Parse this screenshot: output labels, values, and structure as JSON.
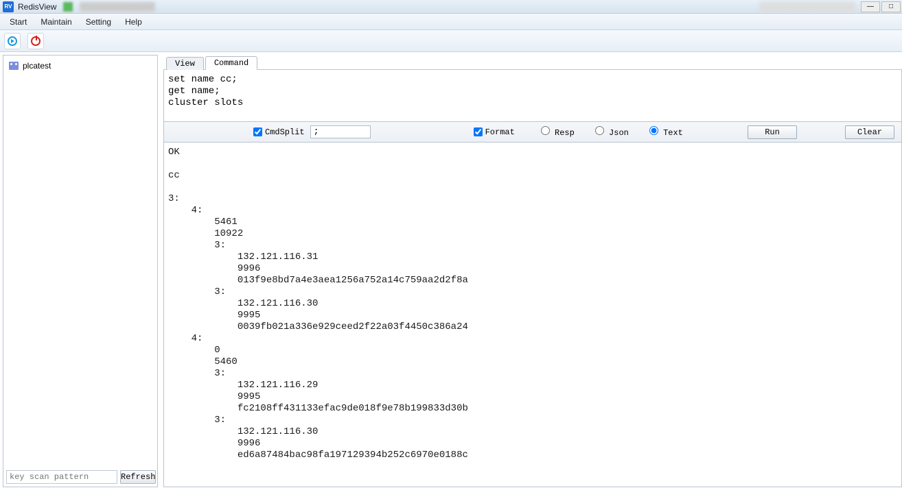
{
  "app": {
    "title": "RedisView"
  },
  "menubar": {
    "start": "Start",
    "maintain": "Maintain",
    "setting": "Setting",
    "help": "Help"
  },
  "sidebar": {
    "tree": {
      "item0": "plcatest"
    },
    "scan_placeholder": "key scan pattern",
    "refresh_label": "Refresh"
  },
  "tabs": {
    "view": "View",
    "command": "Command"
  },
  "command_input": "set name cc;\nget name;\ncluster slots",
  "ctrl": {
    "cmdsplit_label": "CmdSplit",
    "cmdsplit_value": ";",
    "format_label": "Format",
    "resp_label": "Resp",
    "json_label": "Json",
    "text_label": "Text",
    "run_label": "Run",
    "clear_label": "Clear",
    "cmdsplit_checked": true,
    "format_checked": true,
    "format_mode": "Text"
  },
  "output": "OK\n\ncc\n\n3:\n    4:\n        5461\n        10922\n        3:\n            132.121.116.31\n            9996\n            013f9e8bd7a4e3aea1256a752a14c759aa2d2f8a\n        3:\n            132.121.116.30\n            9995\n            0039fb021a336e929ceed2f22a03f4450c386a24\n    4:\n        0\n        5460\n        3:\n            132.121.116.29\n            9995\n            fc2108ff431133efac9de018f9e78b199833d30b\n        3:\n            132.121.116.30\n            9996\n            ed6a87484bac98fa197129394b252c6970e0188c"
}
